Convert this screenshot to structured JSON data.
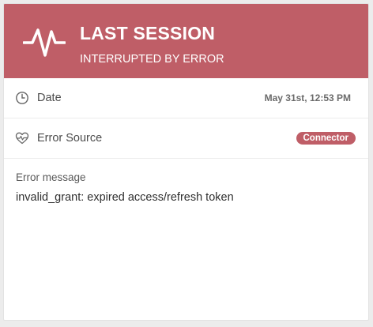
{
  "colors": {
    "header_bg": "#bf5e67",
    "badge_bg": "#bf5e67"
  },
  "header": {
    "icon": "pulse-icon",
    "title": "LAST SESSION",
    "subtitle": "INTERRUPTED BY ERROR"
  },
  "rows": {
    "date": {
      "icon": "clock-icon",
      "label": "Date",
      "value": "May 31st, 12:53 PM"
    },
    "error_source": {
      "icon": "heart-pulse-icon",
      "label": "Error Source",
      "badge": "Connector"
    }
  },
  "error": {
    "label": "Error message",
    "text": "invalid_grant: expired access/refresh token"
  }
}
